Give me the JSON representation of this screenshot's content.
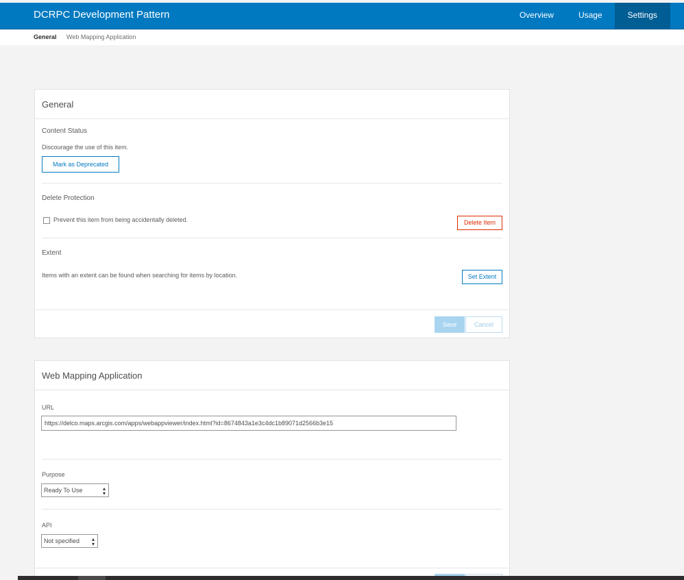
{
  "header": {
    "title": "DCRPC Development Pattern",
    "nav": [
      "Overview",
      "Usage",
      "Settings"
    ]
  },
  "subnav": {
    "current": "General",
    "other": "Web Mapping Application"
  },
  "general": {
    "heading": "General",
    "content_status": {
      "label": "Content Status",
      "text": "Discourage the use of this item.",
      "button": "Mark as Deprecated"
    },
    "delete_protection": {
      "label": "Delete Protection",
      "checkbox_label": "Prevent this item from being accidentally deleted.",
      "button": "Delete Item"
    },
    "extent": {
      "label": "Extent",
      "text": "Items with an extent can be found when searching for items by location.",
      "button": "Set Extent"
    },
    "save": "Save",
    "cancel": "Cancel"
  },
  "webapp": {
    "heading": "Web Mapping Application",
    "url_label": "URL",
    "url_value": "https://delco.maps.arcgis.com/apps/webappviewer/index.html?id=8674843a1e3c4dc1b89071d2566b3e15",
    "purpose_label": "Purpose",
    "purpose_value": "Ready To Use",
    "api_label": "API",
    "api_value": "Not specified"
  },
  "colors": {
    "brand": "#0079c1",
    "brand_dark": "#005e95",
    "danger": "#de2900"
  }
}
